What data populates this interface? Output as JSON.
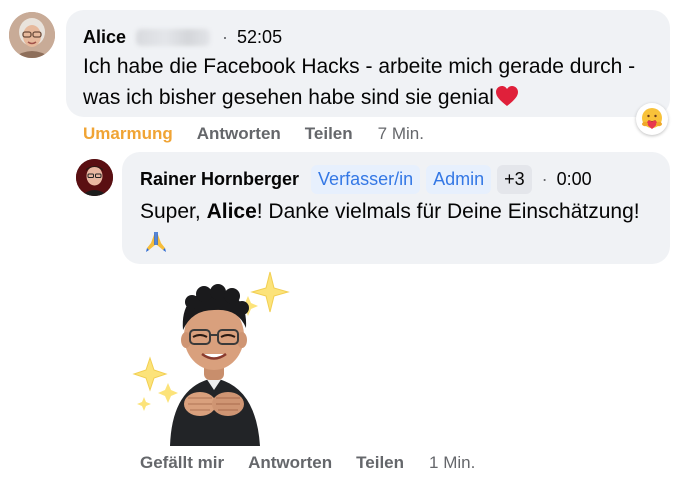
{
  "comment": {
    "author": "Alice",
    "time": "52:05",
    "dot": "·",
    "text": "Ich habe die Facebook Hacks - arbeite mich gerade durch - was ich bisher gesehen habe sind sie genial",
    "reaction_icon": "hug-emoji-icon",
    "actions": {
      "hug": "Umarmung",
      "reply": "Antworten",
      "share": "Teilen",
      "age": "7 Min."
    },
    "colors": {
      "active_reaction": "#f0a435",
      "bubble": "#f0f2f5",
      "muted": "#65676b"
    }
  },
  "reply": {
    "author": "Rainer Hornberger",
    "badges": {
      "author_badge": "Verfasser/in",
      "admin_badge": "Admin",
      "more_badge": "+3"
    },
    "dot": "·",
    "time": "0:00",
    "text_prefix": "Super, ",
    "mention": "Alice",
    "text_suffix": "! Danke vielmals für Deine Einschätzung!",
    "sticker_icon": "avatar-hug-sticker-icon",
    "actions": {
      "like": "Gefällt mir",
      "reply": "Antworten",
      "share": "Teilen",
      "age": "1 Min."
    },
    "colors": {
      "badge_bg": "#e7f0fd",
      "badge_text": "#3478e5"
    }
  }
}
